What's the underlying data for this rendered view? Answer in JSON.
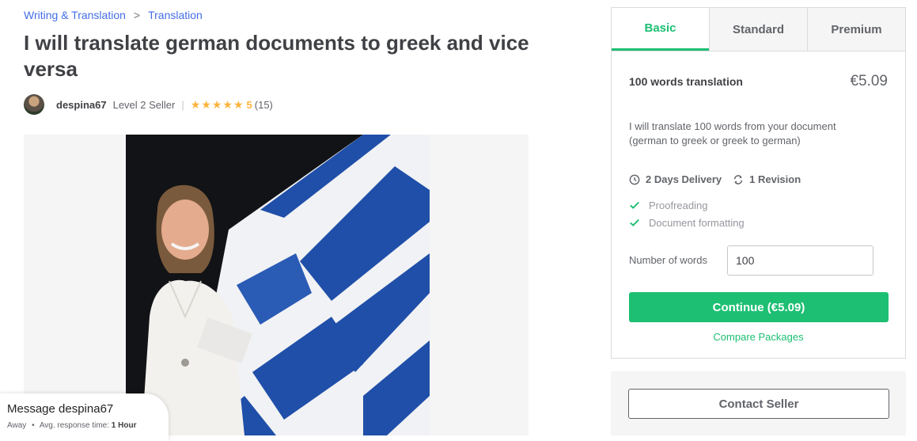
{
  "breadcrumb": {
    "category": "Writing & Translation",
    "subcategory": "Translation",
    "separator": ">"
  },
  "gig": {
    "title": "I will translate german documents to greek and vice versa",
    "seller": {
      "name": "despina67",
      "level": "Level 2 Seller",
      "rating": "5",
      "reviews": "(15)",
      "stars": "★★★★★"
    }
  },
  "message": {
    "title": "Message despina67",
    "status": "Away",
    "dot": "•",
    "response_prefix": "Avg. response time:",
    "response_time": "1 Hour"
  },
  "packages": {
    "tabs": [
      "Basic",
      "Standard",
      "Premium"
    ],
    "active_tab": "Basic",
    "basic": {
      "name": "100 words translation",
      "price": "€5.09",
      "description": "I will translate 100 words from your document (german to greek or greek to german)",
      "delivery": "2 Days Delivery",
      "revisions": "1 Revision",
      "features": [
        "Proofreading",
        "Document formatting"
      ],
      "words_label": "Number of words",
      "words_value": "100",
      "continue_label": "Continue (€5.09)",
      "compare_label": "Compare Packages"
    }
  },
  "contact": {
    "label": "Contact Seller"
  },
  "colors": {
    "accent": "#1dbf73",
    "link": "#446ee7",
    "star": "#ffb33e",
    "flag_blue": "#1f4fa8"
  }
}
